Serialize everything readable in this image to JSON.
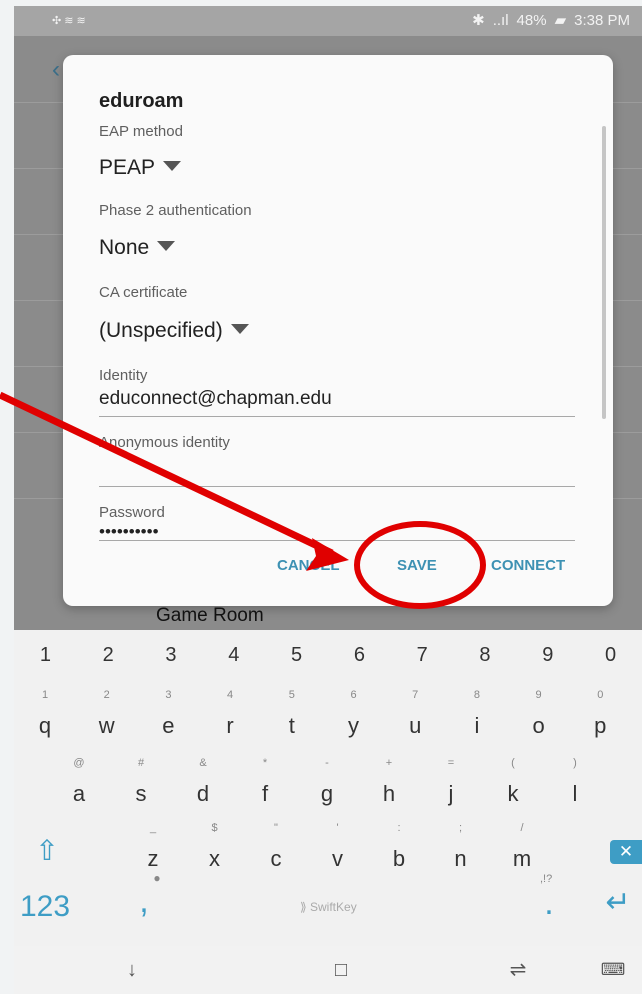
{
  "status": {
    "notification_icon": "network-icon",
    "bluetooth": "✱",
    "icons": "✣ ≋ ≋",
    "network": "..ıl",
    "battery_text": "48%",
    "time": "3:38 PM"
  },
  "background": {
    "network_name": "Game Room"
  },
  "dialog": {
    "title": "eduroam",
    "fields": {
      "eap_label": "EAP method",
      "eap_value": "PEAP",
      "phase2_label": "Phase 2 authentication",
      "phase2_value": "None",
      "ca_label": "CA certificate",
      "ca_value": "(Unspecified)",
      "identity_label": "Identity",
      "identity_value": "educonnect@chapman.edu",
      "anonymous_label": "Anonymous identity",
      "anonymous_value": "",
      "password_label": "Password",
      "password_value": "••••••••••"
    },
    "actions": {
      "cancel": "CANCEL",
      "save": "SAVE",
      "connect": "CONNECT"
    }
  },
  "keyboard": {
    "number_row": [
      "1",
      "2",
      "3",
      "4",
      "5",
      "6",
      "7",
      "8",
      "9",
      "0"
    ],
    "row1": [
      {
        "main": "q",
        "hint": "1"
      },
      {
        "main": "w",
        "hint": "2"
      },
      {
        "main": "e",
        "hint": "3"
      },
      {
        "main": "r",
        "hint": "4"
      },
      {
        "main": "t",
        "hint": "5"
      },
      {
        "main": "y",
        "hint": "6"
      },
      {
        "main": "u",
        "hint": "7"
      },
      {
        "main": "i",
        "hint": "8"
      },
      {
        "main": "o",
        "hint": "9"
      },
      {
        "main": "p",
        "hint": "0"
      }
    ],
    "row2": [
      {
        "main": "a",
        "hint": "@"
      },
      {
        "main": "s",
        "hint": "#"
      },
      {
        "main": "d",
        "hint": "&"
      },
      {
        "main": "f",
        "hint": "*"
      },
      {
        "main": "g",
        "hint": "-"
      },
      {
        "main": "h",
        "hint": "+"
      },
      {
        "main": "j",
        "hint": "="
      },
      {
        "main": "k",
        "hint": "("
      },
      {
        "main": "l",
        "hint": ")"
      }
    ],
    "row3": [
      {
        "main": "z",
        "hint": "_"
      },
      {
        "main": "x",
        "hint": "$"
      },
      {
        "main": "c",
        "hint": "\""
      },
      {
        "main": "v",
        "hint": "'"
      },
      {
        "main": "b",
        "hint": ":"
      },
      {
        "main": "n",
        "hint": ";"
      },
      {
        "main": "m",
        "hint": "/"
      }
    ],
    "mode": "123",
    "comma": ",",
    "space_label": "SwiftKey",
    "period": ".",
    "period_hint": ",!?",
    "shift_icon": "⇧",
    "backspace_icon": "✕",
    "mic_icon": "●",
    "enter_icon": "↵"
  },
  "navbar": {
    "back": "↓",
    "home": "□",
    "recent": "⇌",
    "keyboard": "⌨"
  },
  "colors": {
    "accent": "#3d91b3",
    "arrow": "#e00000",
    "circle": "#e00000"
  }
}
